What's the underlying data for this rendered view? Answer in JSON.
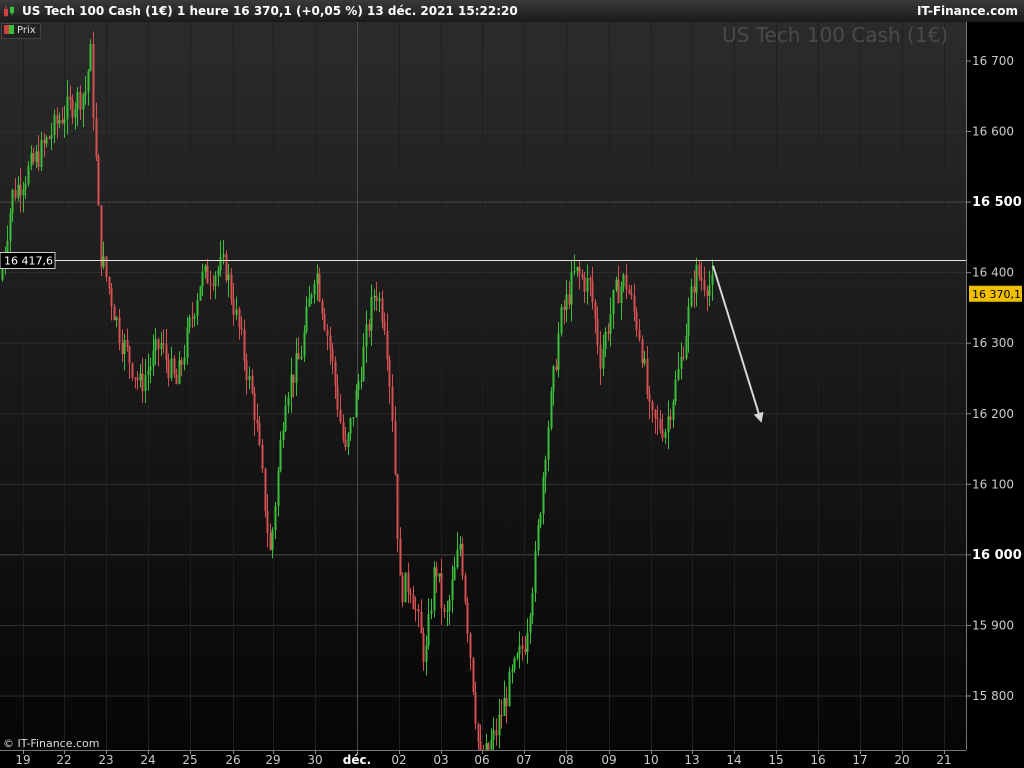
{
  "header": {
    "title": "US Tech 100 Cash (1€) 1 heure 16 370,1 (+0,05 %) 13 déc. 2021 15:22:20",
    "brand": "IT-Finance.com"
  },
  "legend": {
    "label": "Prix"
  },
  "watermark": "US Tech 100 Cash (1€)",
  "copyright": "© IT-Finance.com",
  "colors": {
    "up": "#3bbf3b",
    "down": "#d55050",
    "background": "#000000",
    "grid": "#2e2e2e",
    "last_price_bg": "#f0c000"
  },
  "chart_data": {
    "type": "candlestick",
    "interval": "1 heure",
    "y_ticks": [
      {
        "v": 16700,
        "t": "16 700",
        "bold": false
      },
      {
        "v": 16600,
        "t": "16 600",
        "bold": false
      },
      {
        "v": 16500,
        "t": "16 500",
        "bold": true
      },
      {
        "v": 16400,
        "t": "16 400",
        "bold": false
      },
      {
        "v": 16300,
        "t": "16 300",
        "bold": false
      },
      {
        "v": 16200,
        "t": "16 200",
        "bold": false
      },
      {
        "v": 16100,
        "t": "16 100",
        "bold": false
      },
      {
        "v": 16000,
        "t": "16 000",
        "bold": true
      },
      {
        "v": 15900,
        "t": "15 900",
        "bold": false
      },
      {
        "v": 15800,
        "t": "15 800",
        "bold": false
      }
    ],
    "x_ticks": [
      "19",
      "22",
      "23",
      "24",
      "25",
      "26",
      "29",
      "30",
      "déc.",
      "02",
      "03",
      "06",
      "07",
      "08",
      "09",
      "10",
      "13",
      "14",
      "15",
      "16",
      "17",
      "20",
      "21"
    ],
    "ylim": [
      15715,
      16760
    ],
    "reference_line": {
      "value": 16417.6,
      "label": "16 417,6"
    },
    "last_price": {
      "value": 16370.1,
      "label": "16 370,1"
    },
    "projection_arrow": {
      "from": 16410,
      "to": 16190,
      "from_session": "13",
      "to_session": "15"
    },
    "anchors": [
      [
        0,
        16390
      ],
      [
        12,
        16510
      ],
      [
        40,
        16570
      ],
      [
        60,
        16620
      ],
      [
        86,
        16660
      ],
      [
        90,
        16720
      ],
      [
        100,
        16430
      ],
      [
        120,
        16310
      ],
      [
        140,
        16240
      ],
      [
        160,
        16300
      ],
      [
        176,
        16240
      ],
      [
        200,
        16390
      ],
      [
        225,
        16410
      ],
      [
        240,
        16310
      ],
      [
        255,
        16200
      ],
      [
        270,
        16000
      ],
      [
        285,
        16230
      ],
      [
        300,
        16280
      ],
      [
        315,
        16410
      ],
      [
        330,
        16290
      ],
      [
        345,
        16140
      ],
      [
        360,
        16260
      ],
      [
        375,
        16380
      ],
      [
        385,
        16330
      ],
      [
        392,
        16200
      ],
      [
        400,
        15950
      ],
      [
        410,
        15960
      ],
      [
        425,
        15850
      ],
      [
        435,
        15990
      ],
      [
        445,
        15900
      ],
      [
        460,
        16020
      ],
      [
        470,
        15860
      ],
      [
        480,
        15700
      ],
      [
        495,
        15745
      ],
      [
        510,
        15820
      ],
      [
        525,
        15880
      ],
      [
        535,
        15990
      ],
      [
        545,
        16150
      ],
      [
        560,
        16330
      ],
      [
        575,
        16400
      ],
      [
        590,
        16380
      ],
      [
        600,
        16280
      ],
      [
        615,
        16370
      ],
      [
        625,
        16390
      ],
      [
        640,
        16310
      ],
      [
        650,
        16190
      ],
      [
        665,
        16180
      ],
      [
        680,
        16270
      ],
      [
        695,
        16400
      ],
      [
        712,
        16380
      ]
    ]
  }
}
